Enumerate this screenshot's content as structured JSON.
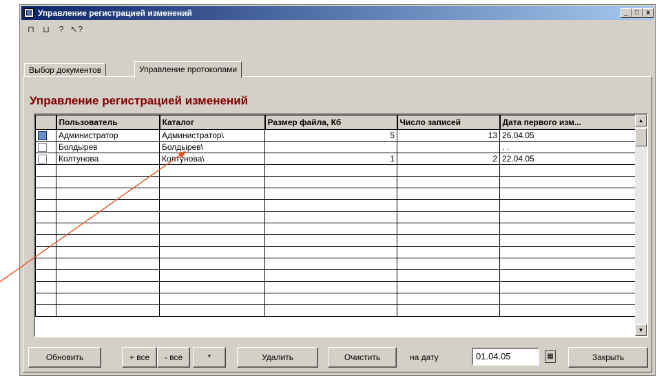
{
  "window": {
    "title": "Управление регистрацией изменений",
    "icon": "document-icon",
    "controls": [
      "_",
      "□",
      "x"
    ]
  },
  "toolbar": [
    "lock-icon",
    "unlock-icon",
    "help-icon",
    "context-help-icon"
  ],
  "tabs": [
    {
      "label": "Выбор документов",
      "active": false
    },
    {
      "label": "Управление протоколами",
      "active": true
    }
  ],
  "heading": "Управление регистрацией изменений",
  "table": {
    "columns": [
      "",
      "Пользователь",
      "Каталог",
      "Размер файла, Кб",
      "Число записей",
      "Дата первого изм..."
    ],
    "rows": [
      {
        "checked": true,
        "user": "Администратор",
        "catalog": "Администратор\\",
        "size": "5",
        "records": "13",
        "date": "26.04.05"
      },
      {
        "checked": false,
        "user": "Болдырев",
        "catalog": "Болдырев\\",
        "size": "",
        "records": "",
        "date": ". ."
      },
      {
        "checked": false,
        "user": "Колтунова",
        "catalog": "Колтунова\\",
        "size": "1",
        "records": "2",
        "date": "22.04.05"
      }
    ],
    "empty_rows": 13
  },
  "buttons": {
    "refresh": "Обновить",
    "plus_all": "+ все",
    "minus_all": "- все",
    "star": "*",
    "delete": "Удалить",
    "clear": "Очистить",
    "close": "Закрыть"
  },
  "date_label": "на дату",
  "date_value": "01.04.05",
  "annotation_color": "#e05020"
}
